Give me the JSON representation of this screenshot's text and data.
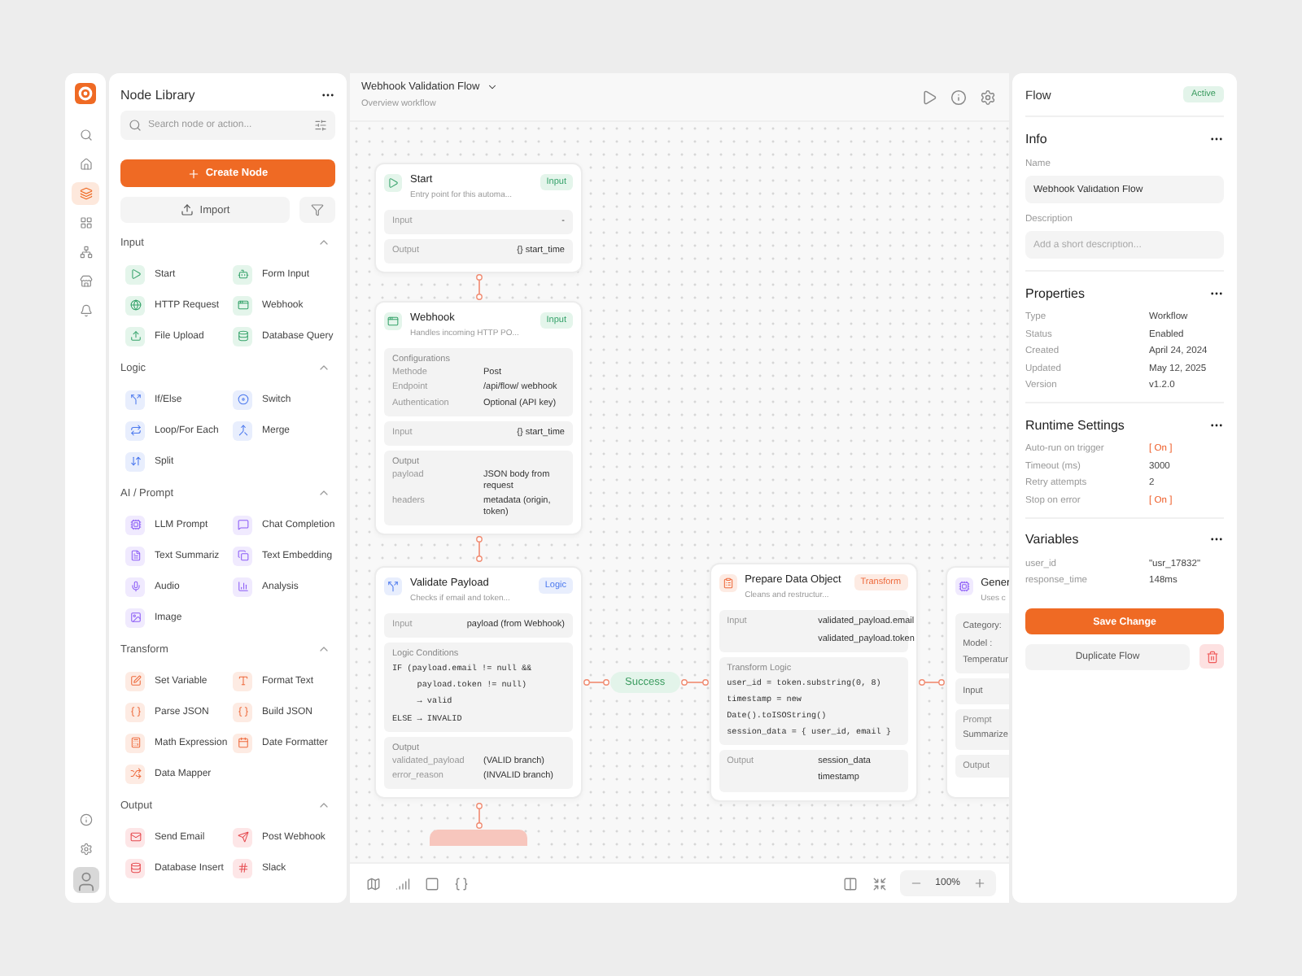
{
  "rail": {
    "nav": [
      {
        "selected": false
      },
      {
        "selected": false
      },
      {
        "selected": true
      },
      {
        "selected": false
      },
      {
        "selected": false
      },
      {
        "selected": false
      },
      {
        "selected": false
      }
    ]
  },
  "library": {
    "title": "Node Library",
    "search": {
      "placeholder": "Search node or action..."
    },
    "create_button": "Create Node",
    "import_button": "Import",
    "sections": [
      {
        "title": "Input",
        "kind": "input",
        "expanded": true,
        "items": [
          "Start",
          "Form Input",
          "HTTP Request",
          "Webhook",
          "File Upload",
          "Database Query"
        ]
      },
      {
        "title": "Logic",
        "kind": "logic",
        "expanded": true,
        "items": [
          "If/Else",
          "Switch",
          "Loop/For Each",
          "Merge",
          "Split"
        ]
      },
      {
        "title": "AI / Prompt",
        "kind": "ai",
        "expanded": true,
        "items": [
          "LLM Prompt",
          "Chat Completion",
          "Text Summariz",
          "Text Embedding",
          "Audio",
          "Analysis",
          "Image"
        ]
      },
      {
        "title": "Transform",
        "kind": "transform",
        "expanded": true,
        "items": [
          "Set Variable",
          "Format Text",
          "Parse JSON",
          "Build JSON",
          "Math Expression",
          "Date Formatter",
          "Data Mapper"
        ]
      },
      {
        "title": "Output",
        "kind": "output",
        "expanded": true,
        "items": [
          "Send Email",
          "Post Webhook",
          "Database Insert",
          "Slack"
        ]
      }
    ]
  },
  "canvas": {
    "title": "Webhook Validation Flow",
    "subtitle": "Overview workflow",
    "edge_label": "Success",
    "zoom": "100%",
    "nodes": [
      {
        "title": "Start",
        "description": "Entry point for this automa...",
        "tag": "Input",
        "kind": "input",
        "blocks": [
          {
            "rows": [
              {
                "label": "Input",
                "value": "-"
              }
            ]
          },
          {
            "rows": [
              {
                "label": "Output",
                "value": "{} start_time"
              }
            ]
          }
        ]
      },
      {
        "title": "Webhook",
        "description": "Handles incoming HTTP PO...",
        "tag": "Input",
        "kind": "input",
        "blocks": [
          {
            "heading": "Configurations",
            "rows": [
              {
                "label": "Methode",
                "value": "Post"
              },
              {
                "label": "Endpoint",
                "value": "/api/flow/ webhook"
              },
              {
                "label": "Authentication",
                "value": "Optional (API key)"
              }
            ]
          },
          {
            "rows": [
              {
                "label": "Input",
                "value": "{} start_time"
              }
            ]
          },
          {
            "heading": "Output",
            "rows": [
              {
                "label": "payload",
                "value": "JSON body from request"
              },
              {
                "label": "headers",
                "value": "metadata (origin, token)"
              }
            ]
          }
        ]
      },
      {
        "title": "Validate Payload",
        "description": "Checks if email and token...",
        "tag": "Logic",
        "kind": "logic",
        "blocks": [
          {
            "rows": [
              {
                "label": "Input",
                "value": "payload (from Webhook)"
              }
            ]
          },
          {
            "heading": "Logic Conditions",
            "code": [
              "IF (payload.email != null &&",
              "     payload.token != null)",
              "     → valid",
              "ELSE → INVALID"
            ]
          },
          {
            "heading": "Output",
            "rows": [
              {
                "label": "validated_payload",
                "value": "(VALID branch)"
              },
              {
                "label": "error_reason",
                "value": "(INVALID branch)"
              }
            ]
          }
        ]
      },
      {
        "title": "Prepare Data Object",
        "description": "Cleans and restructur...",
        "tag": "Transform",
        "kind": "transform",
        "blocks": [
          {
            "rows": [
              {
                "label": "Input",
                "values": [
                  "validated_payload.email",
                  "validated_payload.token"
                ]
              }
            ]
          },
          {
            "heading": "Transform Logic",
            "code": [
              "user_id = token.substring(0, 8)",
              "timestamp = new",
              "Date().toISOString()",
              "session_data = { user_id, email }"
            ]
          },
          {
            "rows": [
              {
                "label": "Output",
                "values": [
                  "session_data",
                  "timestamp"
                ]
              }
            ]
          }
        ]
      },
      {
        "title": "Gener",
        "description": "Uses c",
        "kind": "ai",
        "blocks": [
          {
            "lines": [
              "Category:",
              "Model :",
              "Temperatur"
            ]
          },
          {
            "lines": [
              "Input"
            ]
          },
          {
            "heading": "Prompt",
            "lines": [
              "Summarize"
            ]
          },
          {
            "heading": "Output"
          }
        ]
      }
    ]
  },
  "inspector": {
    "title": "Flow",
    "status": "Active",
    "info": {
      "title": "Info",
      "name_label": "Name",
      "name_value": "Webhook Validation Flow",
      "description_label": "Description",
      "description_placeholder": "Add a short description..."
    },
    "properties": {
      "title": "Properties",
      "rows": [
        {
          "label": "Type",
          "value": "Workflow"
        },
        {
          "label": "Status",
          "value": "Enabled"
        },
        {
          "label": "Created",
          "value": "April 24, 2024"
        },
        {
          "label": "Updated",
          "value": "May 12, 2025"
        },
        {
          "label": "Version",
          "value": "v1.2.0"
        }
      ]
    },
    "runtime": {
      "title": "Runtime Settings",
      "rows": [
        {
          "label": "Auto-run on trigger",
          "value": "[ On ]",
          "kind": "flag"
        },
        {
          "label": "Timeout (ms)",
          "value": "3000",
          "kind": "text"
        },
        {
          "label": "Retry attempts",
          "value": "2",
          "kind": "text"
        },
        {
          "label": "Stop on error",
          "value": "[ On ]",
          "kind": "flag"
        }
      ]
    },
    "variables": {
      "title": "Variables",
      "rows": [
        {
          "label": "user_id",
          "value": "\"usr_17832\""
        },
        {
          "label": "response_time",
          "value": "148ms"
        }
      ]
    },
    "save_button": "Save Change",
    "duplicate_button": "Duplicate Flow"
  }
}
